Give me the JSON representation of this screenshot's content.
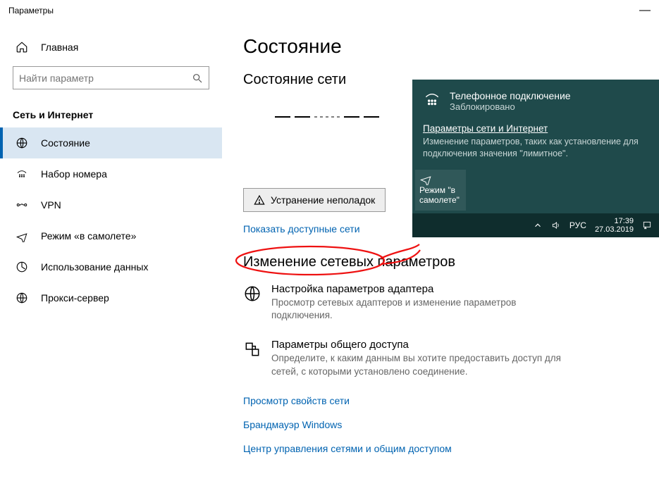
{
  "titlebar": {
    "title": "Параметры"
  },
  "sidebar": {
    "home": "Главная",
    "search_placeholder": "Найти параметр",
    "category": "Сеть и Интернет",
    "items": [
      {
        "label": "Состояние"
      },
      {
        "label": "Набор номера"
      },
      {
        "label": "VPN"
      },
      {
        "label": "Режим «в самолете»"
      },
      {
        "label": "Использование данных"
      },
      {
        "label": "Прокси-сервер"
      }
    ]
  },
  "main": {
    "h1": "Состояние",
    "h2": "Состояние сети",
    "troubleshoot_btn": "Устранение неполадок",
    "show_networks_link": "Показать доступные сети",
    "section_h": "Изменение сетевых параметров",
    "adapter_title": "Настройка параметров адаптера",
    "adapter_desc": "Просмотр сетевых адаптеров и изменение параметров подключения.",
    "sharing_title": "Параметры общего доступа",
    "sharing_desc": "Определите, к каким данным вы хотите предоставить доступ для сетей, с которыми установлено соединение.",
    "links": {
      "view_properties": "Просмотр свойств сети",
      "firewall": "Брандмауэр Windows",
      "sharing_center": "Центр управления сетями и общим доступом"
    }
  },
  "flyout": {
    "conn_title": "Телефонное подключение",
    "conn_status": "Заблокировано",
    "settings_link": "Параметры сети и Интернет",
    "settings_desc": "Изменение параметров, таких как установление для подключения значения \"лимитное\".",
    "airplane_tile": "Режим \"в самолете\"",
    "taskbar": {
      "lang": "РУС",
      "time": "17:39",
      "date": "27.03.2019"
    }
  }
}
